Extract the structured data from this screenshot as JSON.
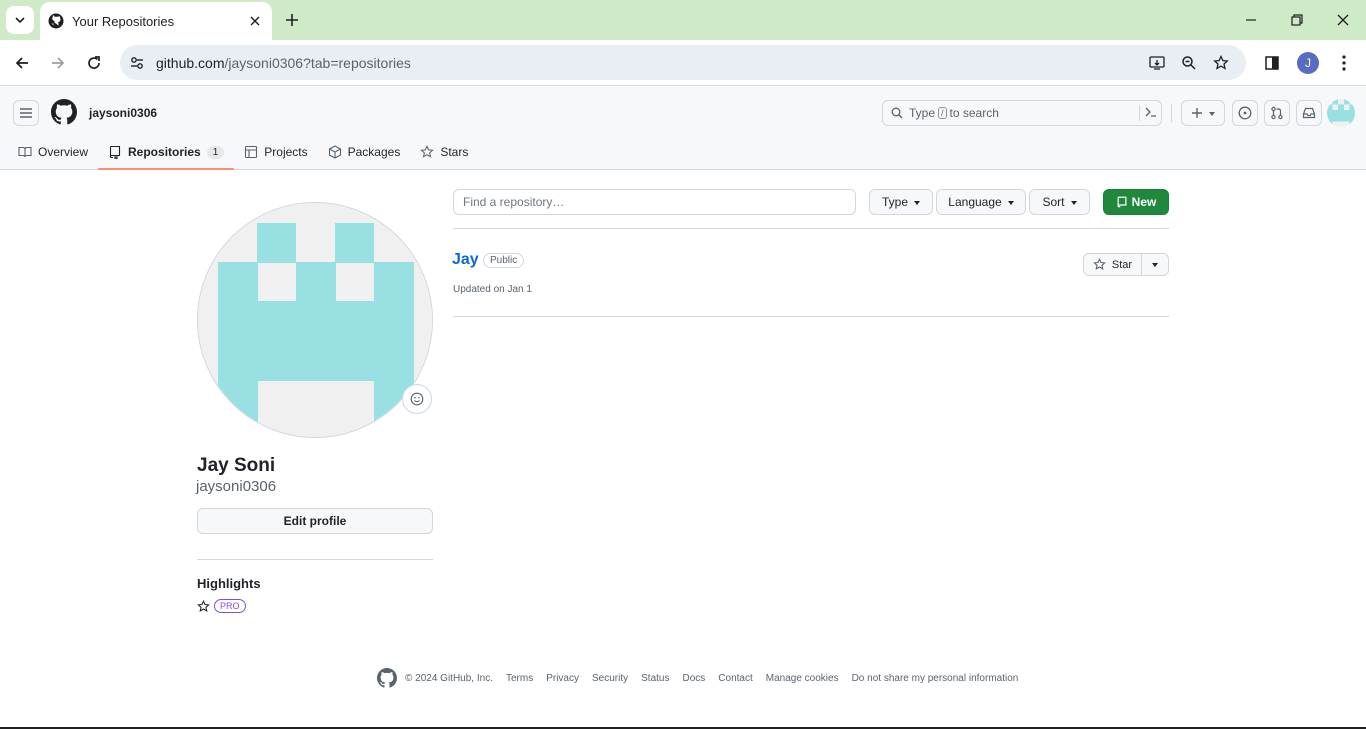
{
  "browser": {
    "tab_title": "Your Repositories",
    "url_host": "github.com",
    "url_path": "/jaysoni0306?tab=repositories",
    "profile_initial": "J"
  },
  "header": {
    "username": "jaysoni0306",
    "search_pre": "Type",
    "search_key": "/",
    "search_post": "to search"
  },
  "profile_tabs": [
    {
      "label": "Overview",
      "icon": "book-icon"
    },
    {
      "label": "Repositories",
      "icon": "repo-icon",
      "count": "1",
      "active": true
    },
    {
      "label": "Projects",
      "icon": "table-icon"
    },
    {
      "label": "Packages",
      "icon": "package-icon"
    },
    {
      "label": "Stars",
      "icon": "star-icon"
    }
  ],
  "sidebar": {
    "full_name": "Jay Soni",
    "login": "jaysoni0306",
    "edit_profile": "Edit profile",
    "highlights_title": "Highlights",
    "pro_badge": "PRO"
  },
  "filters": {
    "find_placeholder": "Find a repository…",
    "type_label": "Type",
    "language_label": "Language",
    "sort_label": "Sort",
    "new_label": "New"
  },
  "repositories": [
    {
      "name": "Jay",
      "visibility": "Public",
      "updated": "Updated on Jan 1",
      "star_label": "Star"
    }
  ],
  "footer": {
    "copyright": "© 2024 GitHub, Inc.",
    "links": [
      "Terms",
      "Privacy",
      "Security",
      "Status",
      "Docs",
      "Contact",
      "Manage cookies",
      "Do not share my personal information"
    ]
  },
  "colors": {
    "tabstrip": "#cfeac7",
    "accent_green": "#1f883d",
    "link_blue": "#0969da",
    "identicon": "#98e0e2",
    "tab_underline": "#fd8c73"
  }
}
